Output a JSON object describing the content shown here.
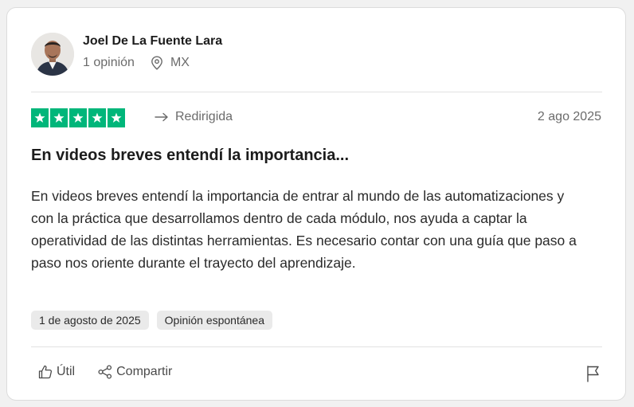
{
  "reviewer": {
    "name": "Joel De La Fuente Lara",
    "reviews_count": "1 opinión",
    "country": "MX"
  },
  "review": {
    "rating": 5,
    "rating_max": 5,
    "redirect_label": "Redirigida",
    "date": "2 ago 2025",
    "title": "En videos breves entendí la importancia...",
    "body": "En videos breves entendí la importancia de entrar al mundo de las automatizaciones y con la práctica que desarrollamos dentro de cada módulo, nos ayuda a captar la operatividad de las distintas herramientas. Es necesario contar con una guía que paso a paso nos oriente durante el trayecto del aprendizaje.",
    "tags": [
      "1 de agosto de 2025",
      "Opinión espontánea"
    ]
  },
  "actions": {
    "useful_label": "Útil",
    "share_label": "Compartir"
  },
  "icons": {
    "location": "location-pin-icon",
    "redirect": "arrow-redirect-icon",
    "useful": "thumbs-up-icon",
    "share": "share-icon",
    "report": "flag-icon"
  },
  "colors": {
    "star_green": "#00b67a",
    "muted_text": "#6b6b6b"
  }
}
